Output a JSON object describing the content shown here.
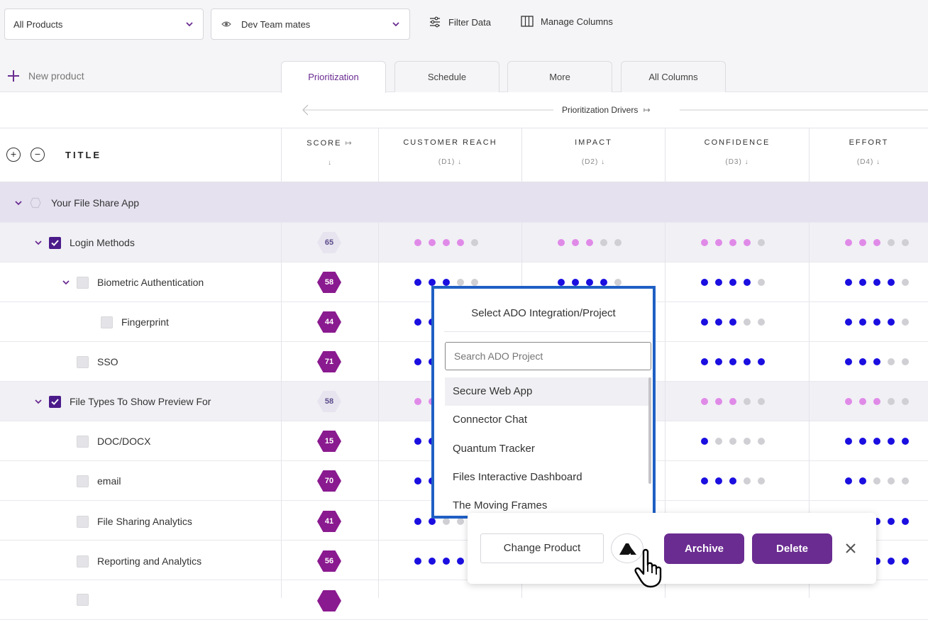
{
  "toolbar": {
    "product_select": "All Products",
    "team_select": "Dev Team mates",
    "filter_label": "Filter Data",
    "manage_columns_label": "Manage Columns"
  },
  "new_product_label": "New product",
  "tabs": [
    {
      "label": "Prioritization",
      "active": true
    },
    {
      "label": "Schedule",
      "active": false
    },
    {
      "label": "More",
      "active": false
    },
    {
      "label": "All Columns",
      "active": false
    }
  ],
  "drivers_label": "Prioritization Drivers",
  "columns": {
    "title": "TITLE",
    "score": "SCORE",
    "customer_reach": {
      "label": "CUSTOMER REACH",
      "sub": "(D1)"
    },
    "impact": {
      "label": "IMPACT",
      "sub": "(D2)"
    },
    "confidence": {
      "label": "CONFIDENCE",
      "sub": "(D3)"
    },
    "effort": {
      "label": "EFFORT",
      "sub": "(D4)"
    }
  },
  "rows": [
    {
      "title": "Your File Share App",
      "kind": "group"
    },
    {
      "title": "Login Methods",
      "kind": "parent",
      "score": "65"
    },
    {
      "title": "Biometric Authentication",
      "kind": "child-parent",
      "score": "58"
    },
    {
      "title": "Fingerprint",
      "kind": "grandchild",
      "score": "44"
    },
    {
      "title": "SSO",
      "kind": "child",
      "score": "71"
    },
    {
      "title": "File Types To Show Preview For",
      "kind": "parent",
      "score": "58"
    },
    {
      "title": "DOC/DOCX",
      "kind": "child",
      "score": "15"
    },
    {
      "title": "email",
      "kind": "child",
      "score": "70"
    },
    {
      "title": "File Sharing Analytics",
      "kind": "child",
      "score": "41"
    },
    {
      "title": "Reporting and Analytics",
      "kind": "child",
      "score": "56"
    }
  ],
  "popup": {
    "title": "Select ADO Integration/Project",
    "search_placeholder": "Search ADO Project",
    "items": [
      "Secure Web App",
      "Connector Chat",
      "Quantum Tracker",
      "Files Interactive Dashboard",
      "The Moving Frames"
    ]
  },
  "actions": {
    "change_product": "Change Product",
    "archive": "Archive",
    "delete": "Delete"
  },
  "colors": {
    "brand_purple": "#6a2c91",
    "score_hex": "#8a1a8f",
    "dot_blue": "#1a0ee0",
    "dot_pink": "#e08ae8",
    "dot_grey": "#cfcfd4",
    "popup_border": "#1f5fc4"
  }
}
